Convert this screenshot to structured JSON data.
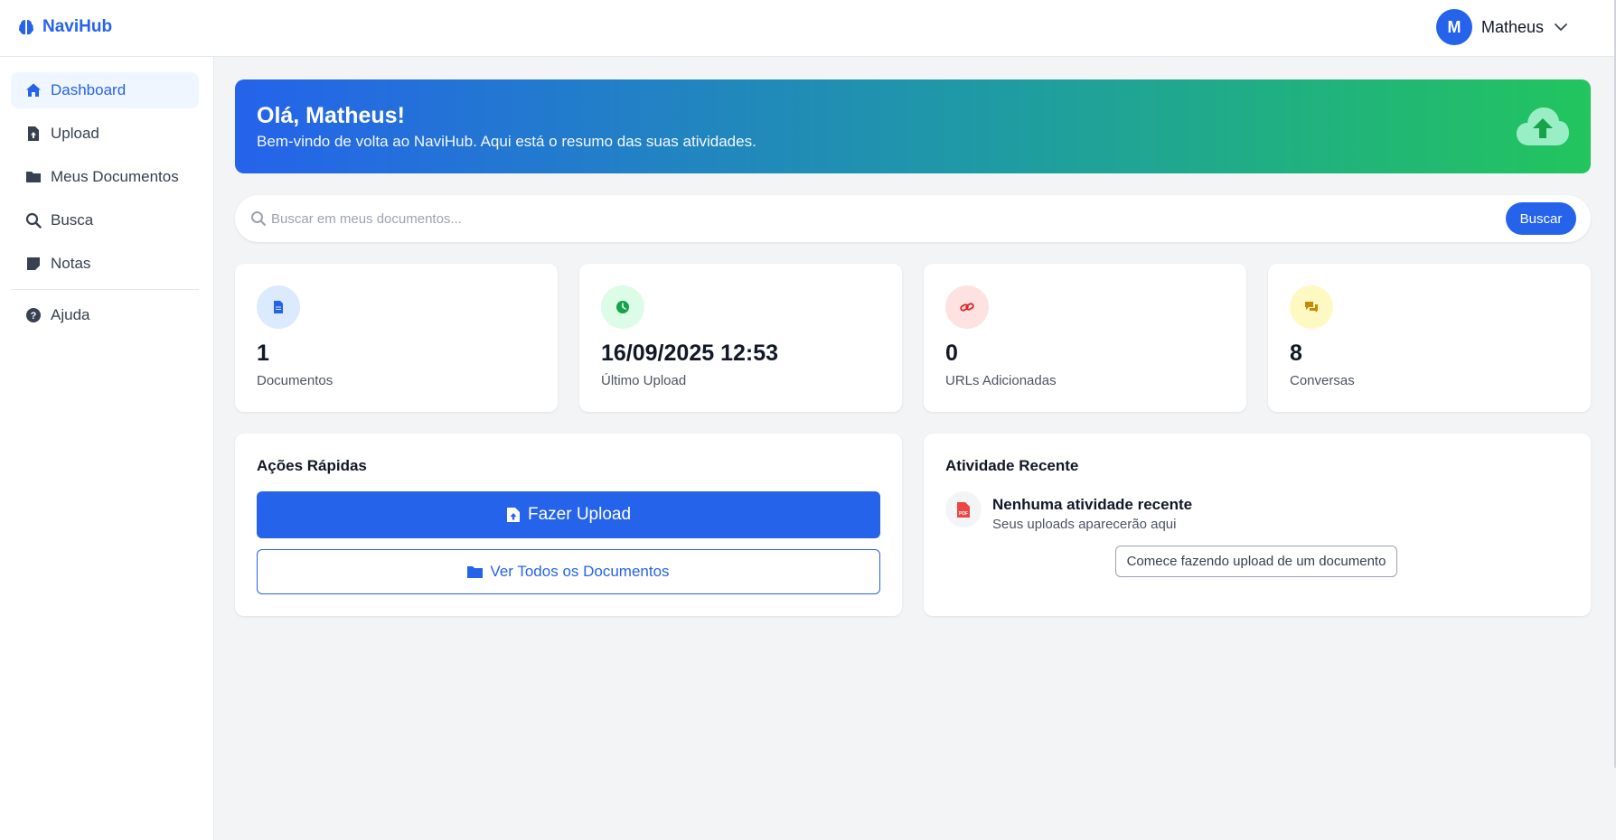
{
  "app": {
    "brand": "NaviHub",
    "brand_icon": "brain-icon"
  },
  "user": {
    "initial": "M",
    "name": "Matheus"
  },
  "sidebar": {
    "items": [
      {
        "label": "Dashboard",
        "icon": "home-icon",
        "active": true
      },
      {
        "label": "Upload",
        "icon": "file-upload-icon"
      },
      {
        "label": "Meus Documentos",
        "icon": "folder-icon"
      },
      {
        "label": "Busca",
        "icon": "search-icon"
      },
      {
        "label": "Notas",
        "icon": "sticky-note-icon"
      }
    ],
    "help": {
      "label": "Ajuda",
      "icon": "question-circle-icon"
    }
  },
  "hero": {
    "title": "Olá, Matheus!",
    "subtitle": "Bem-vindo de volta ao NaviHub. Aqui está o resumo das suas atividades.",
    "icon": "cloud-upload-icon"
  },
  "search": {
    "placeholder": "Buscar em meus documentos...",
    "value": "",
    "button": "Buscar"
  },
  "stats": [
    {
      "value": "1",
      "label": "Documentos",
      "icon": "file-icon",
      "color": "#2563eb",
      "bg": "#dbeafe"
    },
    {
      "value": "16/09/2025 12:53",
      "label": "Último Upload",
      "icon": "clock-icon",
      "color": "#16a34a",
      "bg": "#dcfce7"
    },
    {
      "value": "0",
      "label": "URLs Adicionadas",
      "icon": "link-icon",
      "color": "#dc2626",
      "bg": "#fee2e2"
    },
    {
      "value": "8",
      "label": "Conversas",
      "icon": "comments-icon",
      "color": "#ca8a04",
      "bg": "#fef9c3"
    }
  ],
  "quick_actions": {
    "title": "Ações Rápidas",
    "primary": "Fazer Upload",
    "secondary": "Ver Todos os Documentos"
  },
  "recent": {
    "title": "Atividade Recente",
    "empty_title": "Nenhuma atividade recente",
    "empty_sub": "Seus uploads aparecerão aqui",
    "cta": "Comece fazendo upload de um documento"
  },
  "colors": {
    "accent": "#2563eb",
    "hero_start": "#2563eb",
    "hero_end": "#22c55e"
  }
}
